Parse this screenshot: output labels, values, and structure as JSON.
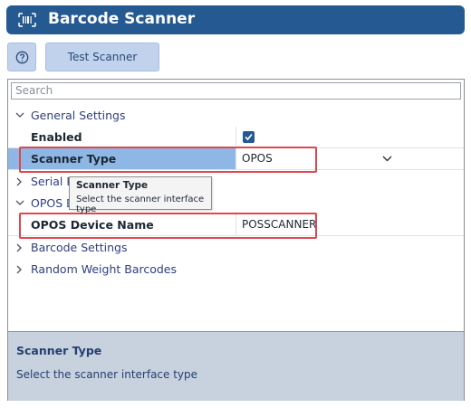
{
  "window": {
    "title": "Barcode Scanner"
  },
  "toolbar": {
    "test_scanner_label": "Test Scanner"
  },
  "search": {
    "placeholder": "Search"
  },
  "categories": {
    "general": "General Settings",
    "serial": "Serial Po",
    "opos": "OPOS D",
    "barcode": "Barcode Settings",
    "random_weight": "Random Weight Barcodes"
  },
  "properties": {
    "enabled": {
      "label": "Enabled",
      "checked": true
    },
    "scanner_type": {
      "label": "Scanner Type",
      "value": "OPOS"
    },
    "opos_device_name": {
      "label": "OPOS Device Name",
      "value": "POSSCANNER"
    }
  },
  "tooltip": {
    "title": "Scanner Type",
    "text": "Select the scanner interface type"
  },
  "description": {
    "title": "Scanner Type",
    "text": "Select the scanner interface type"
  },
  "colors": {
    "accent": "#245a91",
    "highlight": "#e0464e",
    "selection": "#8fb7e6"
  }
}
